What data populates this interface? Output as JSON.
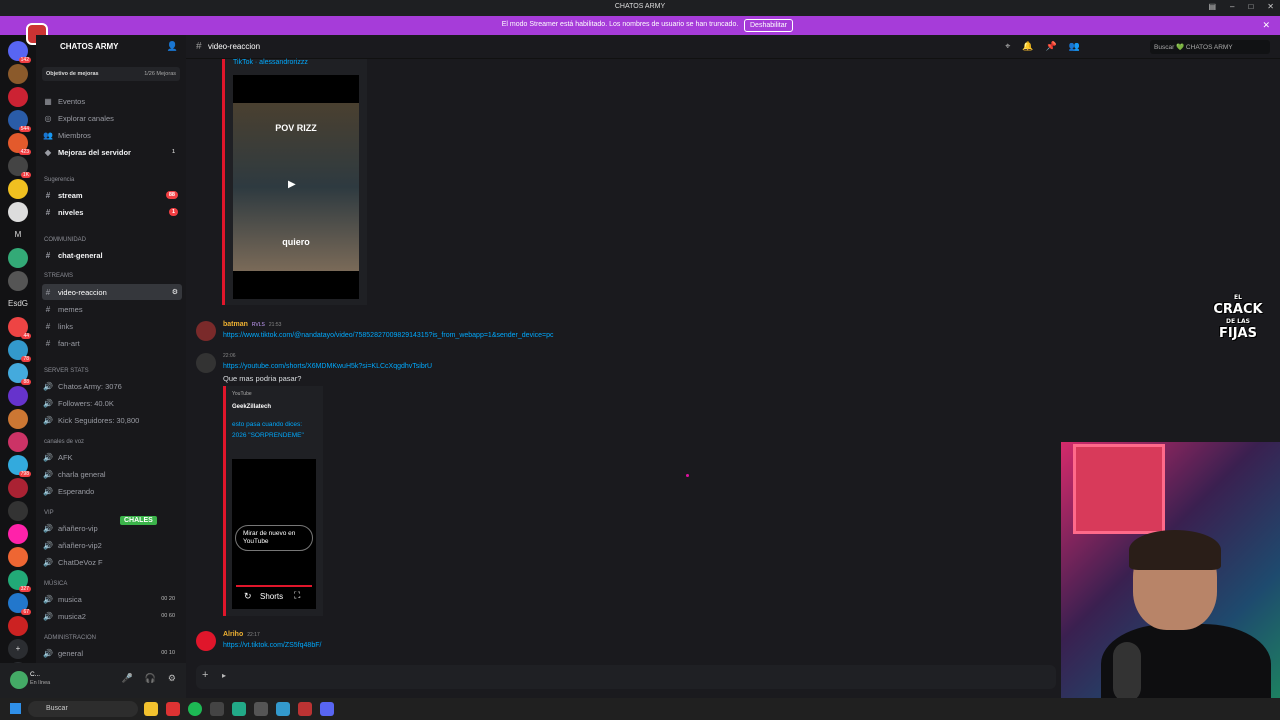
{
  "window": {
    "title": "CHATOS ARMY"
  },
  "banner": {
    "text": "El modo Streamer está habilitado. Los nombres de usuario se han truncado.",
    "button": "Deshabilitar"
  },
  "server": {
    "name": "CHATOS ARMY",
    "boost": {
      "label": "Objetivo de mejoras",
      "progress": "1/26 Mejoras"
    },
    "nav": [
      {
        "label": "Eventos",
        "icon": "calendar-icon"
      },
      {
        "label": "Explorar canales",
        "icon": "compass-icon"
      },
      {
        "label": "Miembros",
        "icon": "members-icon"
      },
      {
        "label": "Mejoras del servidor",
        "icon": "boost-icon",
        "count": "1"
      }
    ],
    "suggest_label": "Sugerencia",
    "suggest": [
      {
        "label": "stream",
        "count": "88"
      },
      {
        "label": "niveles",
        "count": "1"
      }
    ],
    "cat_comunidad": "COMMUNIDAD",
    "chat_general": "chat-general",
    "cat_streams": "STREAMS",
    "streams": [
      {
        "label": "video-reaccion"
      },
      {
        "label": "memes"
      },
      {
        "label": "links"
      },
      {
        "label": "fan-art"
      }
    ],
    "cat_stats": "SERVER STATS",
    "stats": [
      {
        "label": "Chatos Army: 3076"
      },
      {
        "label": "Followers: 40.0K"
      },
      {
        "label": "Kick Seguidores: 30,800"
      }
    ],
    "cat_voz": "canales de voz",
    "voz": [
      {
        "label": "AFK"
      },
      {
        "label": "charla general"
      },
      {
        "label": "Esperando"
      }
    ],
    "cat_vip": "VIP",
    "vip": [
      {
        "label": "añañero-vip"
      },
      {
        "label": "añañero-vip2"
      },
      {
        "label": "ChatDeVoz F"
      }
    ],
    "cat_musica": "MÚSICA",
    "musica": [
      {
        "label": "musica",
        "count": "00 20"
      },
      {
        "label": "musica2",
        "count": "00 60"
      }
    ],
    "cat_admin": "ADMINISTRACION",
    "admin": [
      {
        "label": "general",
        "count": "00 10"
      }
    ]
  },
  "user_panel": {
    "name": "C...",
    "status": "En línea"
  },
  "channel": {
    "name": "video-reaccion",
    "search_placeholder": "Buscar 💚 CHATOS ARMY"
  },
  "messages": {
    "top_embed": {
      "author": "TikTok · alessandrorizzz",
      "overlay_top": "POV RIZZ",
      "overlay_bottom": "quiero"
    },
    "batman": {
      "user": "batman",
      "tag": "RVLS",
      "time": "21:53",
      "link": "https://www.tiktok.com/@nandatayo/video/7585282700982914315?is_from_webapp=1&sender_device=pc"
    },
    "reply": {
      "time": "22:06",
      "link": "https://youtube.com/shorts/X6MDMKwuH5k?si=KLCcXqgdhvTsibrU",
      "text": "Que mas podria pasar?",
      "embed_provider": "YouTube",
      "embed_author": "GeekZillatech",
      "embed_title": "esto pasa cuando dices: 2026 \"SORPRENDEME\"",
      "replay": "Mirar de nuevo en YouTube",
      "shorts": "Shorts"
    },
    "alriho": {
      "user": "Alriho",
      "time": "22:17",
      "link": "https://vt.tiktok.com/ZS5fq48bF/"
    }
  },
  "overlay": {
    "chales": "CHALES",
    "logo_top": "EL",
    "logo_main": "CRACK",
    "logo_mid": "DE LAS",
    "logo_bottom": "FIJAS"
  },
  "taskbar": {
    "search": "Buscar"
  },
  "colors": {
    "accent": "#a63cd9",
    "embed_bar": "#e0162b",
    "link": "#00a8fc",
    "username": "#f0b232"
  }
}
